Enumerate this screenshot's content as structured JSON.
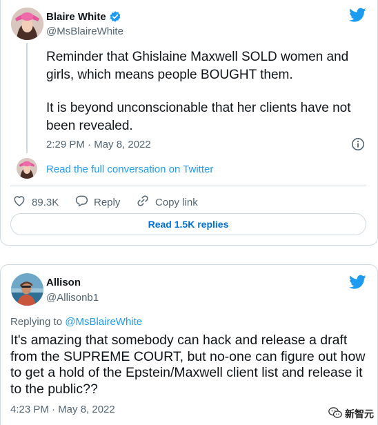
{
  "tweet": {
    "author_name": "Blaire White",
    "author_handle": "@MsBlaireWhite",
    "verified": true,
    "paragraph1": "Reminder that Ghislaine Maxwell SOLD women and girls, which means people BOUGHT them.",
    "paragraph2": "It is beyond unconscionable that her clients have not been revealed.",
    "timestamp": "2:29 PM · May 8, 2022",
    "conversation_link": "Read the full conversation on Twitter",
    "likes": "89.3K",
    "reply_label": "Reply",
    "copy_link_label": "Copy link",
    "read_replies": "Read 1.5K replies"
  },
  "reply_tweet": {
    "author_name": "Allison",
    "author_handle": "@Allisonb1",
    "replying_to_prefix": "Replying to ",
    "replying_to_handle": "@MsBlaireWhite",
    "text": "It's amazing that somebody can hack and release a draft from the SUPREME COURT, but no-one can figure out how to get a hold of the Epstein/Maxwell client list and release it to the public??",
    "timestamp": "4:23 PM · May 8, 2022"
  },
  "watermark": {
    "label": "新智元"
  },
  "colors": {
    "twitter_blue": "#1d9bf0",
    "link_blue": "#006fd6",
    "secondary_text": "#536471",
    "border": "#cfd9de"
  },
  "icons": [
    "twitter-bird-icon",
    "verified-badge-icon",
    "info-icon",
    "heart-icon",
    "reply-icon",
    "link-icon",
    "wechat-icon"
  ]
}
